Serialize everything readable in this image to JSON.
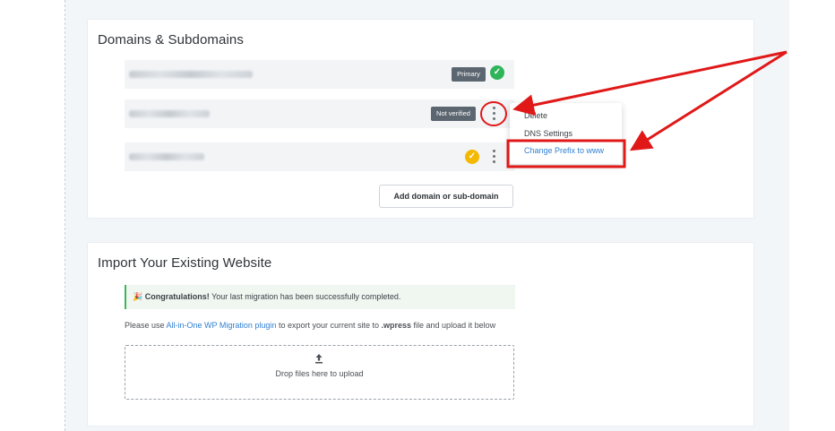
{
  "domains_section": {
    "title": "Domains & Subdomains",
    "rows": [
      {
        "badge": "Primary",
        "status_icon": "check-circle-icon"
      },
      {
        "badge": "Not verified",
        "status_icon": "kebab-menu-icon"
      },
      {
        "badge": "",
        "status_icon": "check-circle-warning-icon"
      }
    ],
    "menu": {
      "items": [
        "Delete",
        "DNS Settings",
        "Change Prefix to www"
      ]
    },
    "add_button": "Add domain or sub-domain"
  },
  "import_section": {
    "title": "Import Your Existing Website",
    "alert": {
      "emoji": "🎉",
      "strong": "Congratulations!",
      "text": " Your last migration has been successfully completed."
    },
    "info": {
      "prefix": "Please use ",
      "link": "All-in-One WP Migration plugin",
      "middle": " to export your current site to ",
      "ext": ".wpress",
      "suffix": " file and upload it below"
    },
    "dropzone_label": "Drop files here to upload"
  },
  "colors": {
    "primary_check": "#2fb45a",
    "warning_check": "#f5b800",
    "annotation_red": "#e01818",
    "link_blue": "#2f7fd1"
  }
}
